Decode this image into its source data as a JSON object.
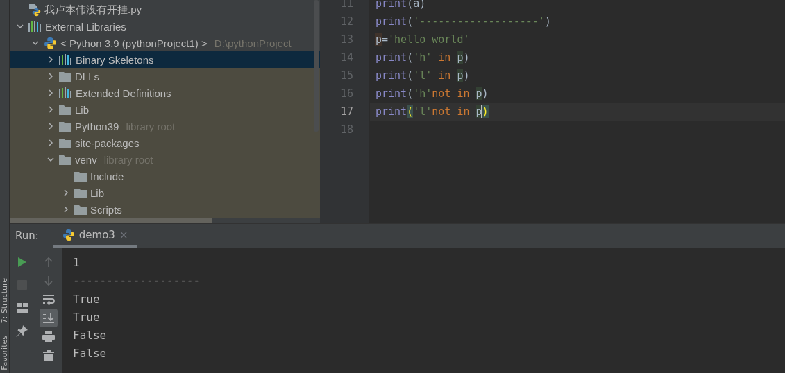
{
  "side_strip": {
    "tabs": [
      {
        "label": "7: Structure"
      },
      {
        "label": "Favorites"
      }
    ]
  },
  "project_tree": {
    "items": [
      {
        "label": "我卢本伟没有开挂.py",
        "kind": "python-file",
        "selected": false
      },
      {
        "label": "External Libraries",
        "kind": "library",
        "expanded": true,
        "selected": false,
        "children": [
          {
            "label": "< Python 3.9 (pythonProject1) >",
            "hint": "D:\\pythonProject",
            "kind": "python",
            "expanded": true,
            "selected": false,
            "children": [
              {
                "label": "Binary Skeletons",
                "kind": "library",
                "expanded": false,
                "selected": true
              },
              {
                "label": "DLLs",
                "kind": "folder",
                "expanded": false,
                "selected": false
              },
              {
                "label": "Extended Definitions",
                "kind": "library",
                "expanded": false,
                "selected": false
              },
              {
                "label": "Lib",
                "kind": "folder",
                "expanded": false,
                "selected": false
              },
              {
                "label": "Python39",
                "hint": "library root",
                "kind": "folder",
                "expanded": false,
                "selected": false
              },
              {
                "label": "site-packages",
                "kind": "folder",
                "expanded": false,
                "selected": false
              },
              {
                "label": "venv",
                "hint": "library root",
                "kind": "folder",
                "expanded": true,
                "selected": false,
                "children": [
                  {
                    "label": "Include",
                    "kind": "folder",
                    "selected": false
                  },
                  {
                    "label": "Lib",
                    "kind": "folder",
                    "expanded": false,
                    "selected": false
                  },
                  {
                    "label": "Scripts",
                    "kind": "folder",
                    "expanded": false,
                    "selected": false
                  }
                ]
              }
            ]
          }
        ]
      }
    ]
  },
  "editor": {
    "lines": [
      {
        "number": "11",
        "current": false,
        "tokens": [
          {
            "text": "print",
            "kind": "builtin"
          },
          {
            "text": "(a)",
            "kind": "plain"
          }
        ]
      },
      {
        "number": "12",
        "current": false,
        "tokens": [
          {
            "text": "print",
            "kind": "builtin"
          },
          {
            "text": "(",
            "kind": "plain"
          },
          {
            "text": "'-------------------'",
            "kind": "string"
          },
          {
            "text": ")",
            "kind": "plain"
          }
        ]
      },
      {
        "number": "13",
        "current": false,
        "tokens": [
          {
            "text": "p",
            "kind": "var-write"
          },
          {
            "text": "=",
            "kind": "plain"
          },
          {
            "text": "'hello world'",
            "kind": "string"
          }
        ]
      },
      {
        "number": "14",
        "current": false,
        "tokens": [
          {
            "text": "print",
            "kind": "builtin"
          },
          {
            "text": "(",
            "kind": "plain"
          },
          {
            "text": "'h'",
            "kind": "string"
          },
          {
            "text": " in ",
            "kind": "keyword"
          },
          {
            "text": "p",
            "kind": "var-read"
          },
          {
            "text": ")",
            "kind": "plain"
          }
        ]
      },
      {
        "number": "15",
        "current": false,
        "tokens": [
          {
            "text": "print",
            "kind": "builtin"
          },
          {
            "text": "(",
            "kind": "plain"
          },
          {
            "text": "'l'",
            "kind": "string"
          },
          {
            "text": " in ",
            "kind": "keyword"
          },
          {
            "text": "p",
            "kind": "var-read"
          },
          {
            "text": ")",
            "kind": "plain"
          }
        ]
      },
      {
        "number": "16",
        "current": false,
        "tokens": [
          {
            "text": "print",
            "kind": "builtin"
          },
          {
            "text": "(",
            "kind": "plain"
          },
          {
            "text": "'h'",
            "kind": "string"
          },
          {
            "text": "not in ",
            "kind": "keyword"
          },
          {
            "text": "p",
            "kind": "var-read"
          },
          {
            "text": ")",
            "kind": "plain"
          }
        ]
      },
      {
        "number": "17",
        "current": true,
        "tokens": [
          {
            "text": "print",
            "kind": "builtin"
          },
          {
            "text": "(",
            "kind": "paren-match"
          },
          {
            "text": "'l'",
            "kind": "string"
          },
          {
            "text": "not in ",
            "kind": "keyword"
          },
          {
            "text": "p",
            "kind": "var-caret"
          },
          {
            "text": ")",
            "kind": "paren-match"
          }
        ]
      },
      {
        "number": "18",
        "current": false
      }
    ]
  },
  "run_panel": {
    "label": "Run:",
    "tabs": [
      {
        "label": "demo3",
        "close": "×",
        "selected": true
      }
    ],
    "left_tools": [
      {
        "kind": "play",
        "disabled": false
      },
      {
        "kind": "stop",
        "disabled": true
      },
      {
        "kind": "layout",
        "disabled": false
      },
      {
        "kind": "pin",
        "disabled": false
      }
    ],
    "right_tools": [
      {
        "kind": "up",
        "disabled": true,
        "on": false
      },
      {
        "kind": "down",
        "disabled": true,
        "on": false
      },
      {
        "kind": "wrap",
        "disabled": false,
        "on": false
      },
      {
        "kind": "scroll-end",
        "disabled": false,
        "on": true
      },
      {
        "kind": "print",
        "disabled": false,
        "on": false
      },
      {
        "kind": "trash",
        "disabled": false,
        "on": false
      }
    ],
    "output": [
      "1",
      "-------------------",
      "True",
      "True",
      "False",
      "False"
    ]
  }
}
